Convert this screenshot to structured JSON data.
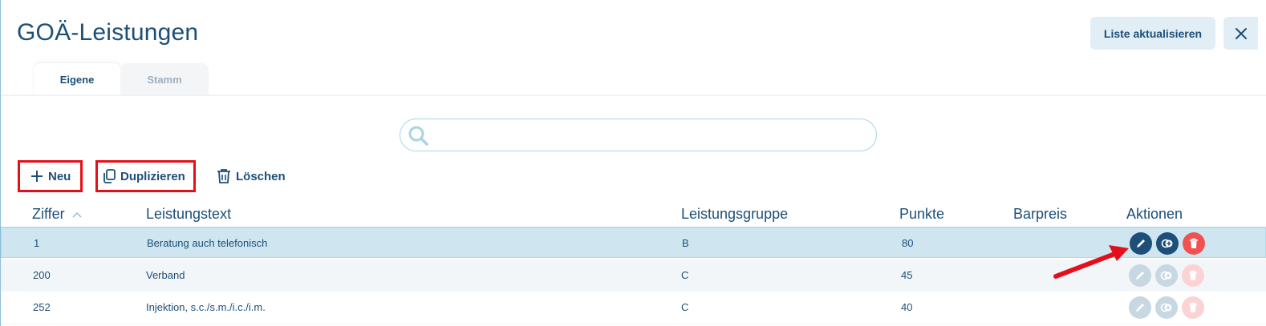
{
  "page": {
    "title": "GOÄ-Leistungen"
  },
  "header": {
    "refresh_label": "Liste aktualisieren",
    "close_icon": "close-icon"
  },
  "tabs": [
    {
      "label": "Eigene",
      "active": true
    },
    {
      "label": "Stamm",
      "active": false
    }
  ],
  "search": {
    "placeholder": "",
    "value": "",
    "icon": "search-icon"
  },
  "toolbar": {
    "new_label": "Neu",
    "duplicate_label": "Duplizieren",
    "delete_label": "Löschen"
  },
  "table": {
    "columns": [
      "Ziffer",
      "Leistungstext",
      "Leistungsgruppe",
      "Punkte",
      "Barpreis",
      "Aktionen"
    ],
    "sort": {
      "column": "Ziffer",
      "direction": "ascending"
    },
    "rows": [
      {
        "ziffer": "1",
        "text": "Beratung auch telefonisch",
        "gruppe": "B",
        "punkte": "80",
        "barpreis": "",
        "selected": true
      },
      {
        "ziffer": "200",
        "text": "Verband",
        "gruppe": "C",
        "punkte": "45",
        "barpreis": "",
        "selected": false
      },
      {
        "ziffer": "252",
        "text": "Injektion, s.c./s.m./i.c./i.m.",
        "gruppe": "C",
        "punkte": "40",
        "barpreis": "",
        "selected": false
      }
    ]
  },
  "colors": {
    "primary": "#1d4f78",
    "highlight_box": "#e3101b",
    "selected_row": "#cfe6f1",
    "delete": "#f05253",
    "annotation_arrow": "#e3101b"
  }
}
